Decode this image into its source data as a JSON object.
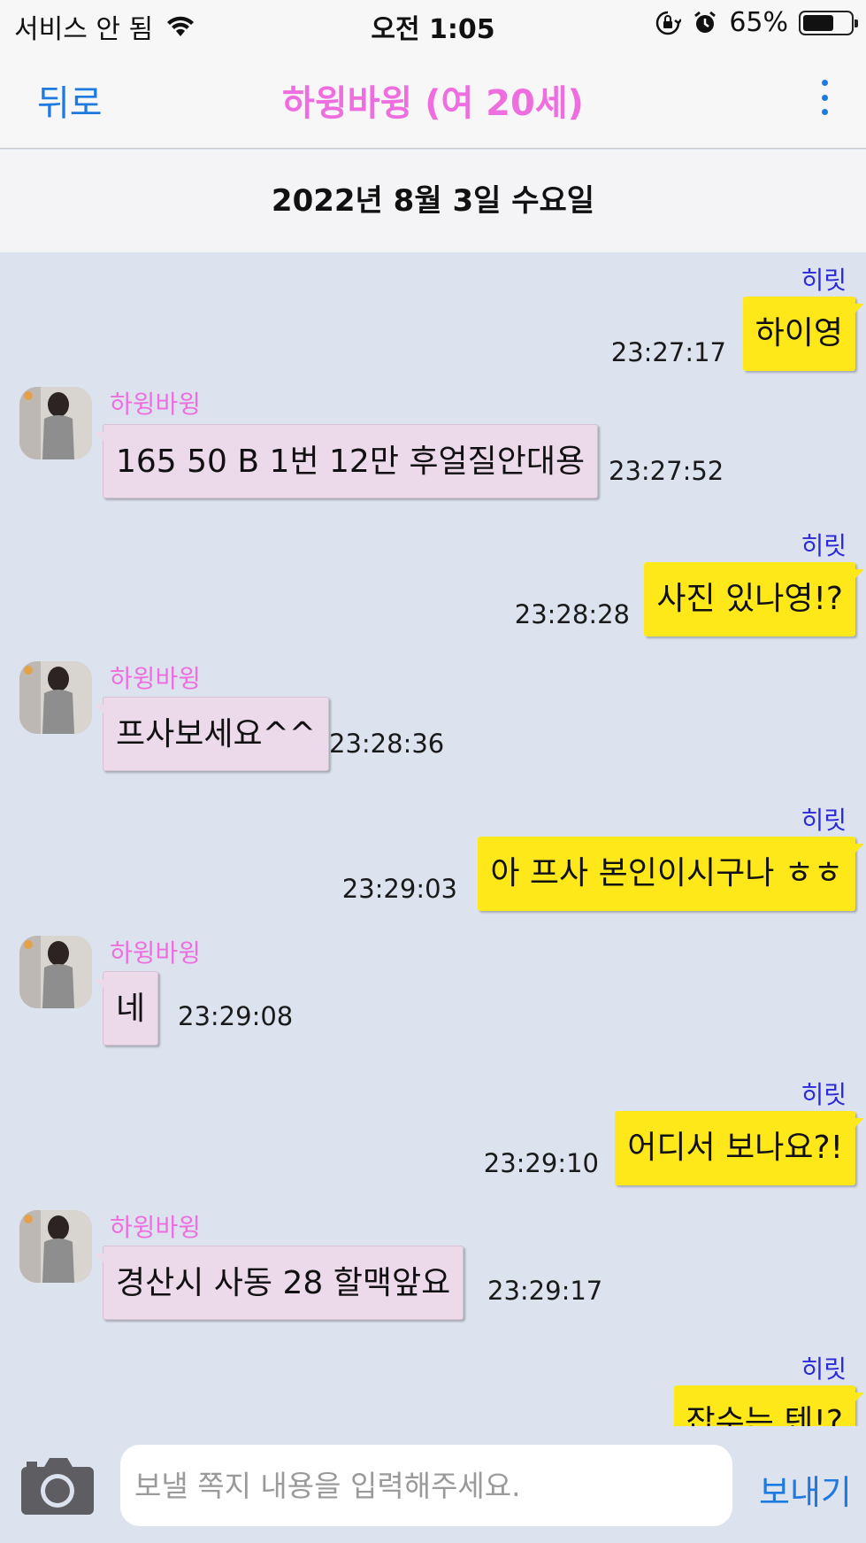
{
  "status_bar": {
    "carrier": "서비스 안 됨",
    "time": "오전 1:05",
    "battery": "65%",
    "battery_level": 0.65
  },
  "nav": {
    "back_label": "뒤로",
    "title": "하윙바윙 (여 20세)"
  },
  "date_header": "2022년 8월 3일 수요일",
  "messages": [
    {
      "from": "mine",
      "sender": "히릿",
      "text": "하이영",
      "time": "23:27:17"
    },
    {
      "from": "theirs",
      "sender": "하윙바윙",
      "text": "165 50 B 1번 12만 후얼질안대용",
      "time": "23:27:52"
    },
    {
      "from": "mine",
      "sender": "히릿",
      "text": "사진 있나영!?",
      "time": "23:28:28"
    },
    {
      "from": "theirs",
      "sender": "하윙바윙",
      "text": "프사보세요^^",
      "time": "23:28:36"
    },
    {
      "from": "mine",
      "sender": "히릿",
      "text": "아 프사 본인이시구나 ㅎㅎ",
      "time": "23:29:03"
    },
    {
      "from": "theirs",
      "sender": "하윙바윙",
      "text": "네",
      "time": "23:29:08"
    },
    {
      "from": "mine",
      "sender": "히릿",
      "text": "어디서 보나요?!",
      "time": "23:29:10"
    },
    {
      "from": "theirs",
      "sender": "하윙바윙",
      "text": "경산시 사동 28 할맥앞요",
      "time": "23:29:17"
    },
    {
      "from": "mine",
      "sender": "히릿",
      "text": "잡수는 텐!?",
      "time": ""
    }
  ],
  "input_bar": {
    "placeholder": "보낼 쪽지 내용을 입력해주세요.",
    "send_label": "보내기"
  },
  "colors": {
    "accent_blue": "#1f7ae0",
    "title_pink": "#ee6ee0",
    "my_bubble": "#ffe81a",
    "their_bubble": "#ecd9ea",
    "chat_bg": "#dde2ef"
  }
}
